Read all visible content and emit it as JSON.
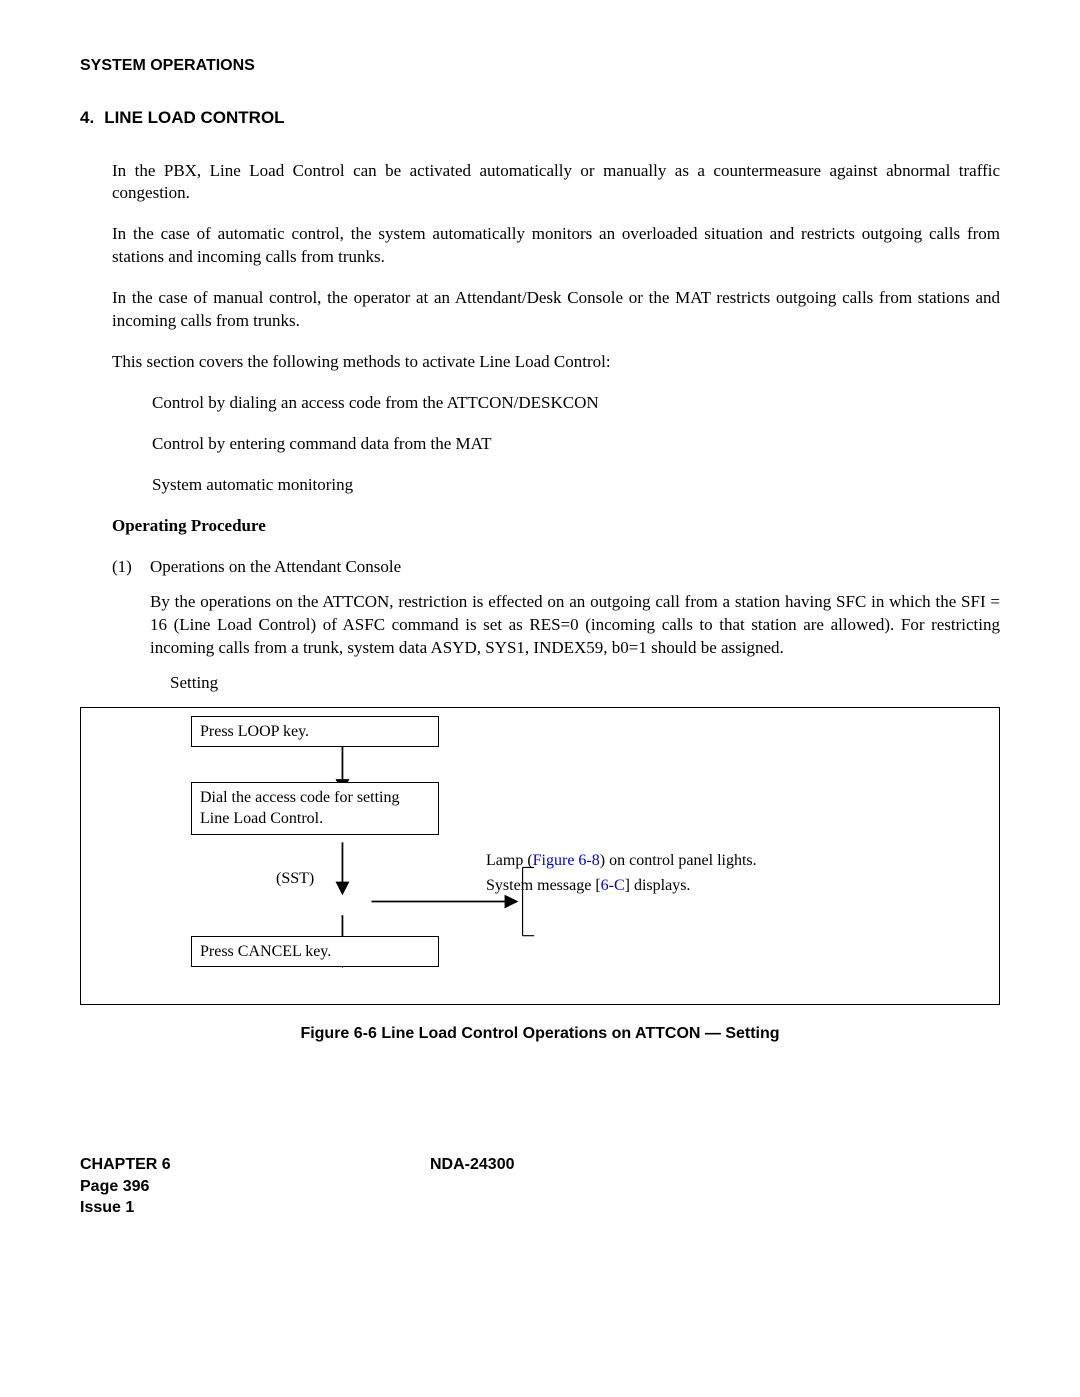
{
  "header": "SYSTEM OPERATIONS",
  "section_num": "4.",
  "section_title": "LINE LOAD CONTROL",
  "p1": "In the PBX, Line Load Control can be activated automatically or manually as a countermeasure against abnormal traffic congestion.",
  "p2": "In the case of automatic control, the system automatically monitors an overloaded situation and restricts outgoing calls from stations and incoming calls from trunks.",
  "p3": "In the case of manual control, the operator at an Attendant/Desk Console or the MAT restricts outgoing calls from stations and incoming calls from trunks.",
  "p4": "This section covers the following methods to activate Line Load Control:",
  "bullets": {
    "b1": "Control by dialing an access code from the ATTCON/DESKCON",
    "b2": "Control by entering command data from the MAT",
    "b3": "System automatic monitoring"
  },
  "subheading": "Operating Procedure",
  "proc_num": "(1)",
  "proc_title": "Operations on the Attendant Console",
  "proc_body": "By the operations on the ATTCON, restriction is effected on an outgoing call from a station having SFC in which the SFI = 16 (Line Load Control) of ASFC command is set as RES=0 (incoming calls to that station are allowed). For restricting incoming calls from a trunk, system data ASYD, SYS1, INDEX59, b0=1 should be assigned.",
  "setting_label": "Setting",
  "flow": {
    "step1": "Press LOOP key.",
    "step2": "Dial the access code for setting Line Load Control.",
    "mid": "(SST)",
    "step3": "Press CANCEL key.",
    "side1a": "Lamp (",
    "side1link": "Figure 6-8",
    "side1b": ") on control panel lights.",
    "side2a": "System message [",
    "side2link": "6-C",
    "side2b": "] displays."
  },
  "caption": "Figure 6-6   Line Load Control Operations on ATTCON — Setting",
  "footer": {
    "chapter": "CHAPTER 6",
    "page": "Page 396",
    "issue": "Issue 1",
    "doc": "NDA-24300"
  }
}
